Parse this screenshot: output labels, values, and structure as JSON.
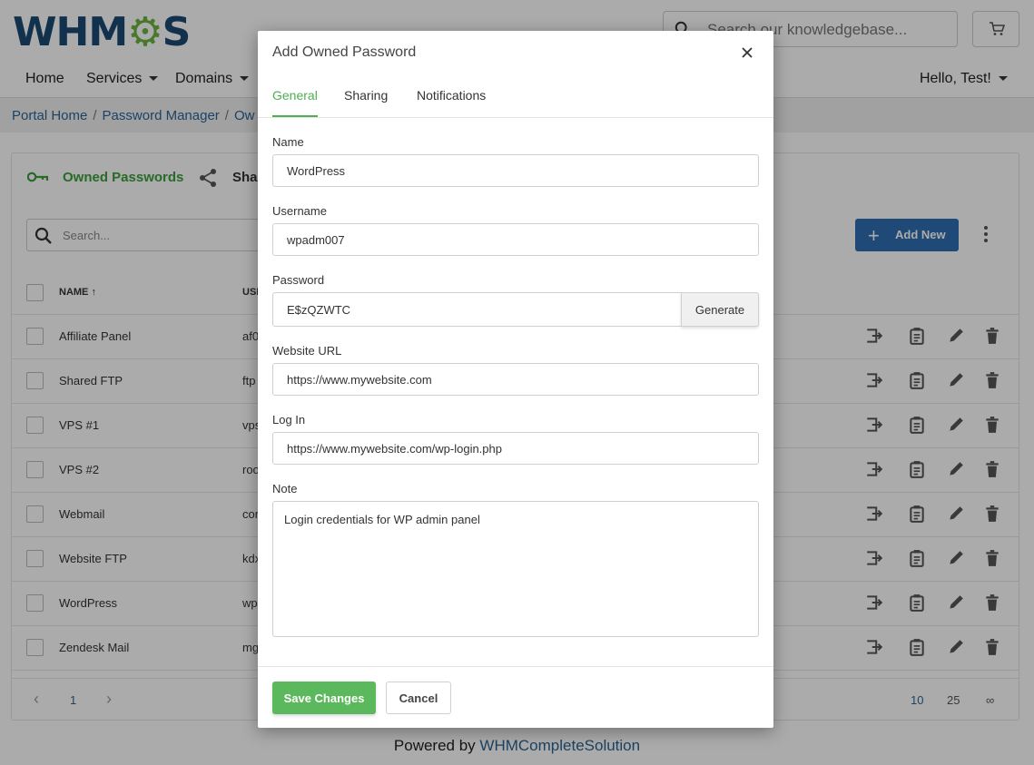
{
  "brand": {
    "logo_text_left": "WHM",
    "logo_gear": "⚙",
    "logo_text_right": "S"
  },
  "header": {
    "search_placeholder": "Search our knowledgebase...",
    "nav": [
      "Home",
      "Services",
      "Domains"
    ],
    "user_menu": "Hello, Test!"
  },
  "breadcrumb": {
    "items": [
      "Portal Home",
      "Password Manager",
      "Ow"
    ]
  },
  "panel": {
    "tab_owned": "Owned Passwords",
    "tab_shared": "Shar",
    "search_placeholder": "Search...",
    "add_new": "Add New",
    "columns": {
      "name": "NAME ↑",
      "username": "USE"
    },
    "rows": [
      {
        "name": "Affiliate Panel",
        "user": "af0"
      },
      {
        "name": "Shared FTP",
        "user": "ftp"
      },
      {
        "name": "VPS #1",
        "user": "vps"
      },
      {
        "name": "VPS #2",
        "user": "roo"
      },
      {
        "name": "Webmail",
        "user": "cor"
      },
      {
        "name": "Website FTP",
        "user": "kdx"
      },
      {
        "name": "WordPress",
        "user": "wp"
      },
      {
        "name": "Zendesk Mail",
        "user": "mg"
      }
    ],
    "pager": {
      "prev": "‹",
      "page": "1",
      "next": "›",
      "sizes": [
        "10",
        "25",
        "∞"
      ]
    }
  },
  "footer": {
    "prefix": "Powered by ",
    "link": "WHMCompleteSolution"
  },
  "modal": {
    "title": "Add Owned Password",
    "tabs": [
      "General",
      "Sharing",
      "Notifications"
    ],
    "fields": {
      "name_label": "Name",
      "name_value": "WordPress",
      "username_label": "Username",
      "username_value": "wpadm007",
      "password_label": "Password",
      "password_value": "E$zQZWTC",
      "generate": "Generate",
      "url_label": "Website URL",
      "url_value": "https://www.mywebsite.com",
      "login_label": "Log In",
      "login_value": "https://www.mywebsite.com/wp-login.php",
      "note_label": "Note",
      "note_value": "Login credentials for WP admin panel"
    },
    "save": "Save Changes",
    "cancel": "Cancel"
  },
  "colors": {
    "accent_green": "#5cb85c",
    "primary_blue": "#2f6eb0",
    "brand_navy": "#1c4a72"
  }
}
